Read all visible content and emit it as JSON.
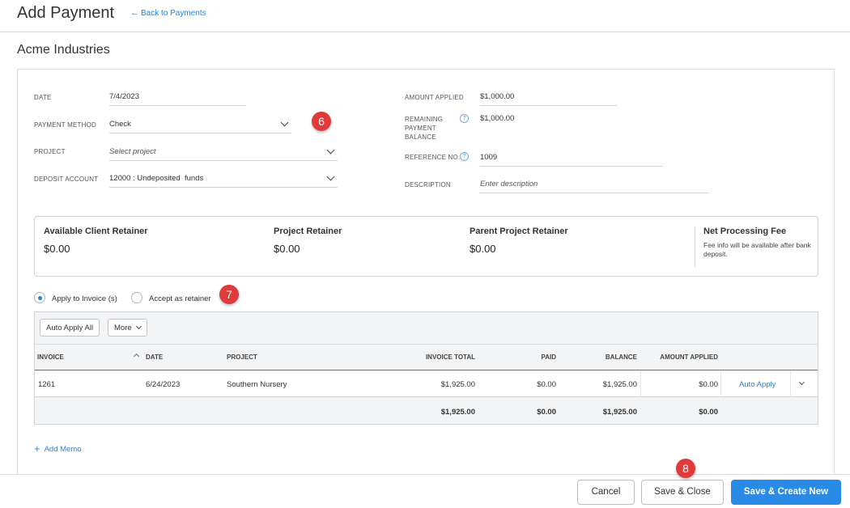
{
  "header": {
    "title": "Add Payment",
    "back_label": "Back to Payments"
  },
  "client": {
    "name": "Acme Industries"
  },
  "form": {
    "date": {
      "label": "DATE",
      "value": "7/4/2023"
    },
    "payment_method": {
      "label": "PAYMENT METHOD",
      "value": "Check"
    },
    "project": {
      "label": "PROJECT",
      "placeholder": "Select project"
    },
    "deposit_account": {
      "label": "DEPOSIT ACCOUNT",
      "value": "12000 : Undeposited  funds"
    },
    "amount_applied": {
      "label": "AMOUNT APPLIED",
      "value": "$1,000.00"
    },
    "remaining_balance": {
      "label_line1": "REMAINING",
      "label_line2": "PAYMENT",
      "label_line3": "BALANCE",
      "value": "$1,000.00"
    },
    "reference_no": {
      "label": "REFERENCE NO.",
      "value": "1009"
    },
    "description": {
      "label": "DESCRIPTION",
      "placeholder": "Enter description"
    },
    "help_glyph": "?"
  },
  "retainers": {
    "available_client": {
      "title": "Available Client Retainer",
      "value": "$0.00"
    },
    "project": {
      "title": "Project Retainer",
      "value": "$0.00"
    },
    "parent_project": {
      "title": "Parent Project Retainer",
      "value": "$0.00"
    },
    "net_processing_fee": {
      "title": "Net Processing Fee",
      "info": "Fee info will be available after bank deposit."
    }
  },
  "apply_options": {
    "apply_to_invoice": "Apply to Invoice (s)",
    "accept_as_retainer": "Accept as retainer",
    "selected": "apply_to_invoice"
  },
  "annotations": {
    "badge_6": "6",
    "badge_7": "7",
    "badge_8": "8"
  },
  "table": {
    "toolbar": {
      "auto_apply_all": "Auto Apply All",
      "more": "More"
    },
    "columns": {
      "invoice": "INVOICE",
      "date": "DATE",
      "project": "PROJECT",
      "invoice_total": "INVOICE TOTAL",
      "paid": "PAID",
      "balance": "BALANCE",
      "amount_applied": "AMOUNT APPLIED"
    },
    "rows": [
      {
        "invoice": "1261",
        "date": "6/24/2023",
        "project": "Southern Nursery",
        "invoice_total": "$1,925.00",
        "paid": "$0.00",
        "balance": "$1,925.00",
        "amount_applied": "$0.00",
        "action": "Auto Apply"
      }
    ],
    "totals": {
      "invoice_total": "$1,925.00",
      "paid": "$0.00",
      "balance": "$1,925.00",
      "amount_applied": "$0.00"
    }
  },
  "add_memo": "Add Memo",
  "footer": {
    "cancel": "Cancel",
    "save_close": "Save & Close",
    "save_new": "Save & Create New"
  },
  "colors": {
    "accent": "#2a7fd4",
    "primary_button": "#2a8ae8",
    "badge": "#e03a3a"
  }
}
